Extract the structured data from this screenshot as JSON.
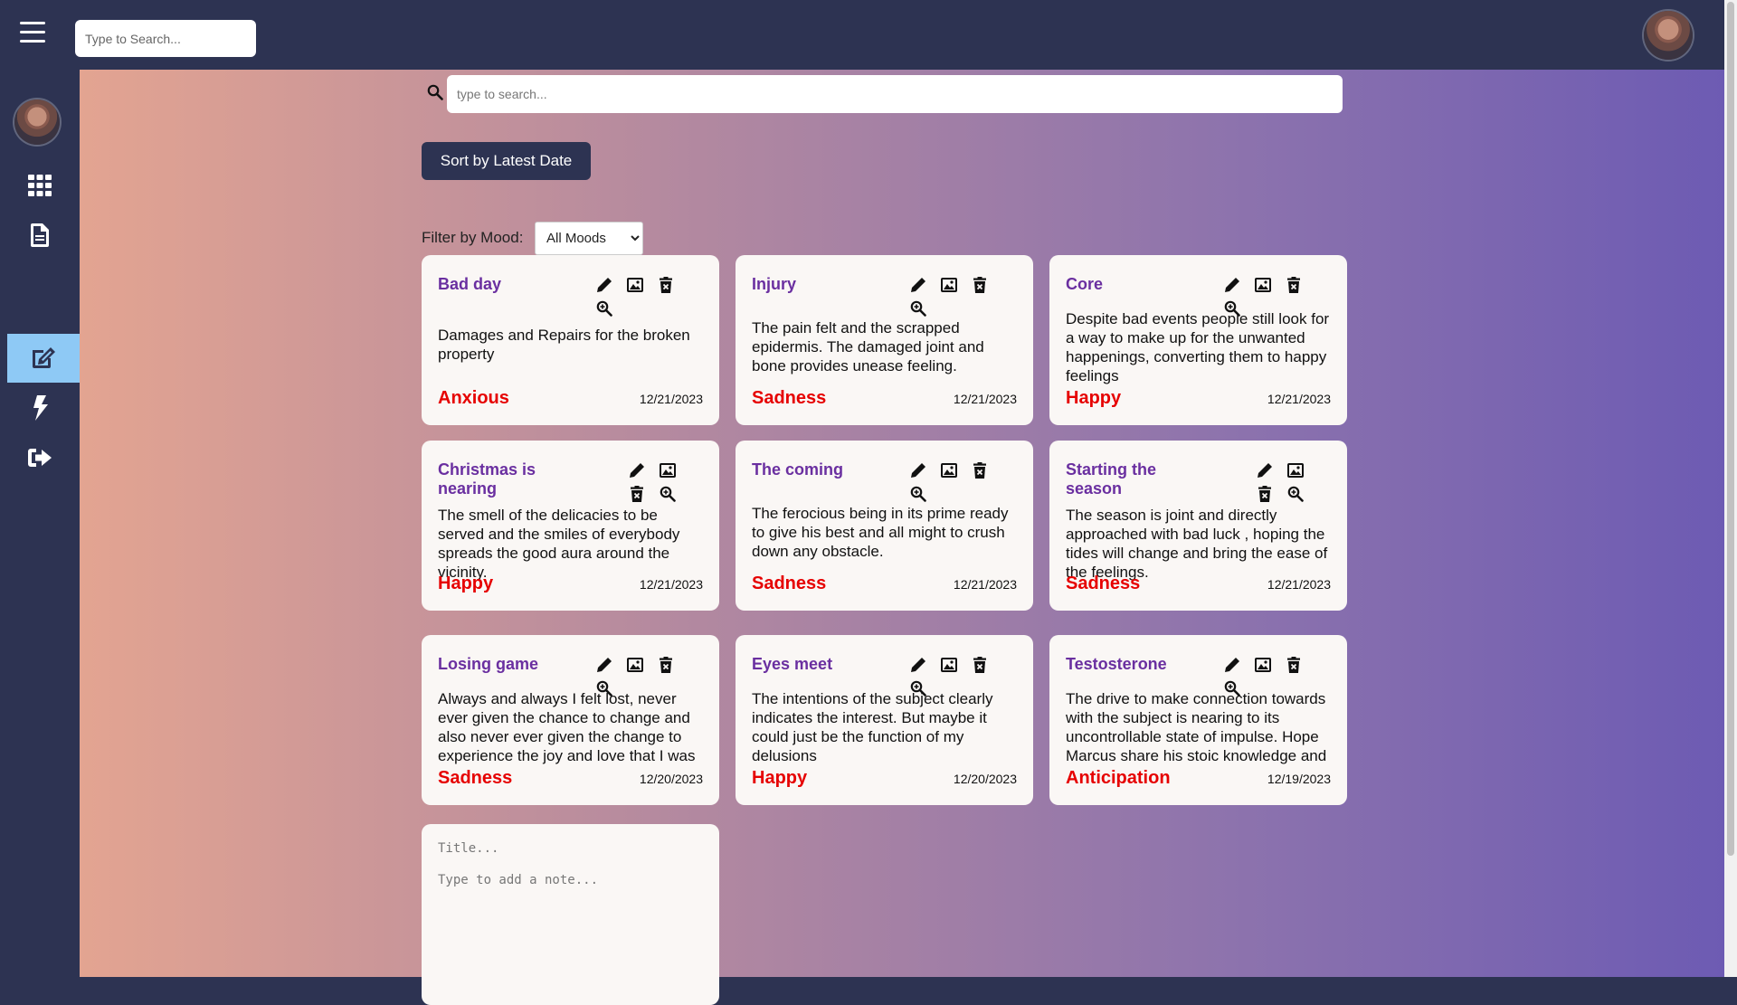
{
  "topbar": {
    "search_placeholder": "Type to Search..."
  },
  "sidebar": {
    "items": [
      {
        "icon": "grid-icon"
      },
      {
        "icon": "document-icon"
      },
      {
        "icon": "edit-icon",
        "active": true
      },
      {
        "icon": "lightning-icon"
      },
      {
        "icon": "logout-icon"
      }
    ]
  },
  "main": {
    "search_placeholder": "type to search...",
    "sort_label": "Sort by Latest Date",
    "filter_label": "Filter by Mood:",
    "mood_options": [
      "All Moods"
    ]
  },
  "notes": [
    {
      "title": "Bad day",
      "body": "Damages and Repairs for the broken property",
      "mood": "Anxious",
      "date": "12/21/2023"
    },
    {
      "title": "Injury",
      "body": "The pain felt and the scrapped epidermis. The damaged joint and bone provides unease feeling.",
      "mood": "Sadness",
      "date": "12/21/2023"
    },
    {
      "title": "Core",
      "body": "Despite bad events people still look for a way to make up for the unwanted happenings, converting them to happy feelings",
      "mood": "Happy",
      "date": "12/21/2023"
    },
    {
      "title": "Christmas is nearing",
      "body": "The smell of the delicacies to be served and the smiles of everybody spreads the good aura around the vicinity.",
      "mood": "Happy",
      "date": "12/21/2023"
    },
    {
      "title": "The coming",
      "body": "The ferocious being in its prime ready to give his best and all might to crush down any obstacle.",
      "mood": "Sadness",
      "date": "12/21/2023"
    },
    {
      "title": "Starting the season",
      "body": "The season is joint and directly approached with bad luck , hoping the tides will change and bring the ease of the feelings.",
      "mood": "Sadness",
      "date": "12/21/2023"
    },
    {
      "title": "Losing game",
      "body": "Always and always I felt lost, never ever given the chance to change and also never ever given the change to experience the joy and love that I was longing.",
      "mood": "Sadness",
      "date": "12/20/2023"
    },
    {
      "title": "Eyes meet",
      "body": "The intentions of the subject clearly indicates the interest. But maybe it could just be the function of my delusions",
      "mood": "Happy",
      "date": "12/20/2023"
    },
    {
      "title": "Testosterone",
      "body": "The drive to make connection towards with the subject is nearing to its uncontrollable state of impulse. Hope Marcus share his stoic knowledge and guide me.",
      "mood": "Anticipation",
      "date": "12/19/2023"
    }
  ],
  "new_note": {
    "title_placeholder": "Title...",
    "body_placeholder": "Type to add a note..."
  },
  "colors": {
    "sidebar_bg": "#2d3352",
    "active_item": "#8ec9f5",
    "note_title": "#6a2fa0",
    "mood_text": "#e60000"
  }
}
